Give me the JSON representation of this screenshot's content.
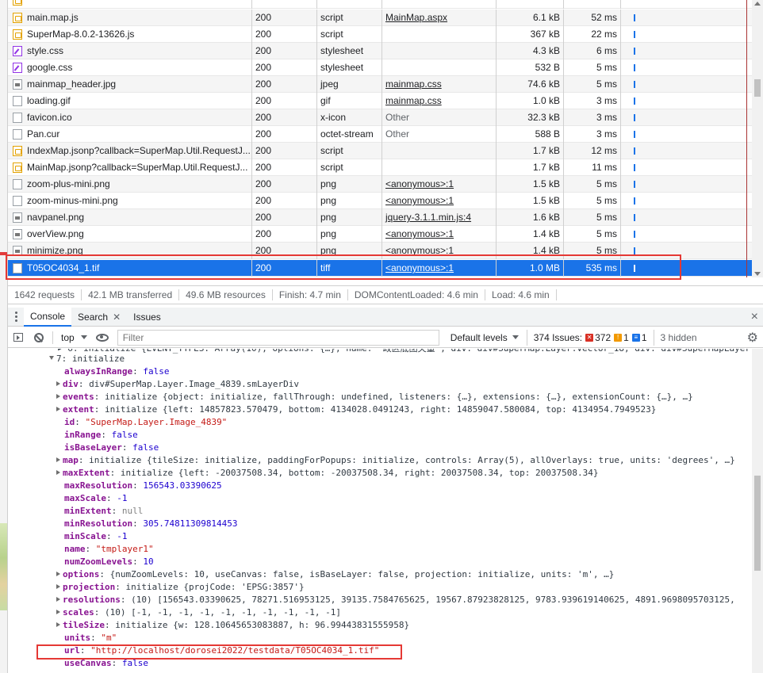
{
  "network": {
    "rows": [
      {
        "name": "",
        "status": "",
        "type": "",
        "initiator": "",
        "size": "",
        "time": "",
        "icon": "js"
      },
      {
        "name": "main.map.js",
        "status": "200",
        "type": "script",
        "initiator": "MainMap.aspx",
        "size": "6.1 kB",
        "time": "52 ms",
        "icon": "js"
      },
      {
        "name": "SuperMap-8.0.2-13626.js",
        "status": "200",
        "type": "script",
        "initiator": "",
        "size": "367 kB",
        "time": "22 ms",
        "icon": "js"
      },
      {
        "name": "style.css",
        "status": "200",
        "type": "stylesheet",
        "initiator": "",
        "size": "4.3 kB",
        "time": "6 ms",
        "icon": "css"
      },
      {
        "name": "google.css",
        "status": "200",
        "type": "stylesheet",
        "initiator": "",
        "size": "532 B",
        "time": "5 ms",
        "icon": "css"
      },
      {
        "name": "mainmap_header.jpg",
        "status": "200",
        "type": "jpeg",
        "initiator": "mainmap.css",
        "size": "74.6 kB",
        "time": "5 ms",
        "icon": "img"
      },
      {
        "name": "loading.gif",
        "status": "200",
        "type": "gif",
        "initiator": "mainmap.css",
        "size": "1.0 kB",
        "time": "3 ms",
        "icon": "doc"
      },
      {
        "name": "favicon.ico",
        "status": "200",
        "type": "x-icon",
        "initiator": "Other",
        "size": "32.3 kB",
        "time": "3 ms",
        "icon": "doc"
      },
      {
        "name": "Pan.cur",
        "status": "200",
        "type": "octet-stream",
        "initiator": "Other",
        "size": "588 B",
        "time": "3 ms",
        "icon": "doc"
      },
      {
        "name": "IndexMap.jsonp?callback=SuperMap.Util.RequestJ...",
        "status": "200",
        "type": "script",
        "initiator": "",
        "size": "1.7 kB",
        "time": "12 ms",
        "icon": "js"
      },
      {
        "name": "MainMap.jsonp?callback=SuperMap.Util.RequestJ...",
        "status": "200",
        "type": "script",
        "initiator": "",
        "size": "1.7 kB",
        "time": "11 ms",
        "icon": "js"
      },
      {
        "name": "zoom-plus-mini.png",
        "status": "200",
        "type": "png",
        "initiator": "<anonymous>:1",
        "size": "1.5 kB",
        "time": "5 ms",
        "icon": "doc"
      },
      {
        "name": "zoom-minus-mini.png",
        "status": "200",
        "type": "png",
        "initiator": "<anonymous>:1",
        "size": "1.5 kB",
        "time": "5 ms",
        "icon": "doc"
      },
      {
        "name": "navpanel.png",
        "status": "200",
        "type": "png",
        "initiator": "jquery-3.1.1.min.js:4",
        "size": "1.6 kB",
        "time": "5 ms",
        "icon": "img"
      },
      {
        "name": "overView.png",
        "status": "200",
        "type": "png",
        "initiator": "<anonymous>:1",
        "size": "1.4 kB",
        "time": "5 ms",
        "icon": "img"
      },
      {
        "name": "minimize.png",
        "status": "200",
        "type": "png",
        "initiator": "<anonymous>:1",
        "size": "1.4 kB",
        "time": "5 ms",
        "icon": "img"
      },
      {
        "name": "T05OC4034_1.tif",
        "status": "200",
        "type": "tiff",
        "initiator": "<anonymous>:1",
        "size": "1.0 MB",
        "time": "535 ms",
        "icon": "doc",
        "selected": true
      }
    ]
  },
  "summary": {
    "requests": "1642 requests",
    "transferred": "42.1 MB transferred",
    "resources": "49.6 MB resources",
    "finish": "Finish: 4.7 min",
    "dcl": "DOMContentLoaded: 4.6 min",
    "load": "Load: 4.6 min"
  },
  "drawer": {
    "tabs": [
      "Console",
      "Search",
      "Issues"
    ],
    "close": "×"
  },
  "console_toolbar": {
    "context": "top",
    "filter_placeholder": "Filter",
    "levels": "Default levels",
    "issues_label": "374 Issues:",
    "err_count": "372",
    "warn_count": "1",
    "info_count": "1",
    "hidden": "3 hidden"
  },
  "console": {
    "top_partial": "▸ 6: initialize {EVENT_TYPES: Array(10), options: {…}, name: \"政区底图矢量\", div: div#SuperMap.Layer.Vector_18, div: div#SuperMapLayer",
    "head": "7: initialize",
    "props": [
      {
        "k": "alwaysInRange",
        "v": "false",
        "t": "num",
        "exp": false
      },
      {
        "k": "div",
        "v": "div#SuperMap.Layer.Image_4839.smLayerDiv",
        "t": "val",
        "exp": true
      },
      {
        "k": "events",
        "v": "initialize {object: initialize, fallThrough: undefined, listeners: {…}, extensions: {…}, extensionCount: {…}, …}",
        "t": "val",
        "exp": true
      },
      {
        "k": "extent",
        "v": "initialize {left: 14857823.570479, bottom: 4134028.0491243, right: 14859047.580084, top: 4134954.7949523}",
        "t": "val",
        "exp": true
      },
      {
        "k": "id",
        "v": "\"SuperMap.Layer.Image_4839\"",
        "t": "str",
        "exp": false
      },
      {
        "k": "inRange",
        "v": "false",
        "t": "num",
        "exp": false
      },
      {
        "k": "isBaseLayer",
        "v": "false",
        "t": "num",
        "exp": false
      },
      {
        "k": "map",
        "v": "initialize {tileSize: initialize, paddingForPopups: initialize, controls: Array(5), allOverlays: true, units: 'degrees', …}",
        "t": "val",
        "exp": true
      },
      {
        "k": "maxExtent",
        "v": "initialize {left: -20037508.34, bottom: -20037508.34, right: 20037508.34, top: 20037508.34}",
        "t": "val",
        "exp": true
      },
      {
        "k": "maxResolution",
        "v": "156543.03390625",
        "t": "num",
        "exp": false
      },
      {
        "k": "maxScale",
        "v": "-1",
        "t": "num",
        "exp": false
      },
      {
        "k": "minExtent",
        "v": "null",
        "t": "nul",
        "exp": false
      },
      {
        "k": "minResolution",
        "v": "305.74811309814453",
        "t": "num",
        "exp": false
      },
      {
        "k": "minScale",
        "v": "-1",
        "t": "num",
        "exp": false
      },
      {
        "k": "name",
        "v": "\"tmplayer1\"",
        "t": "str",
        "exp": false
      },
      {
        "k": "numZoomLevels",
        "v": "10",
        "t": "num",
        "exp": false
      },
      {
        "k": "options",
        "v": "{numZoomLevels: 10, useCanvas: false, isBaseLayer: false, projection: initialize, units: 'm', …}",
        "t": "val",
        "exp": true
      },
      {
        "k": "projection",
        "v": "initialize {projCode: 'EPSG:3857'}",
        "t": "val",
        "exp": true
      },
      {
        "k": "resolutions",
        "v": "(10) [156543.03390625, 78271.516953125, 39135.7584765625, 19567.87923828125, 9783.939619140625, 4891.9698095703125,",
        "t": "val",
        "exp": true
      },
      {
        "k": "scales",
        "v": "(10) [-1, -1, -1, -1, -1, -1, -1, -1, -1, -1]",
        "t": "val",
        "exp": true
      },
      {
        "k": "tileSize",
        "v": "initialize {w: 128.10645653083887, h: 96.99443831555958}",
        "t": "val",
        "exp": true
      },
      {
        "k": "units",
        "v": "\"m\"",
        "t": "str",
        "exp": false
      },
      {
        "k": "url",
        "v": "\"http://localhost/dorosei2022/testdata/T05OC4034_1.tif\"",
        "t": "str",
        "exp": false
      },
      {
        "k": "useCanvas",
        "v": "false",
        "t": "num",
        "exp": false
      }
    ]
  },
  "colors": {
    "selected_row": "#1a73e8",
    "highlight_box": "#e53935"
  }
}
